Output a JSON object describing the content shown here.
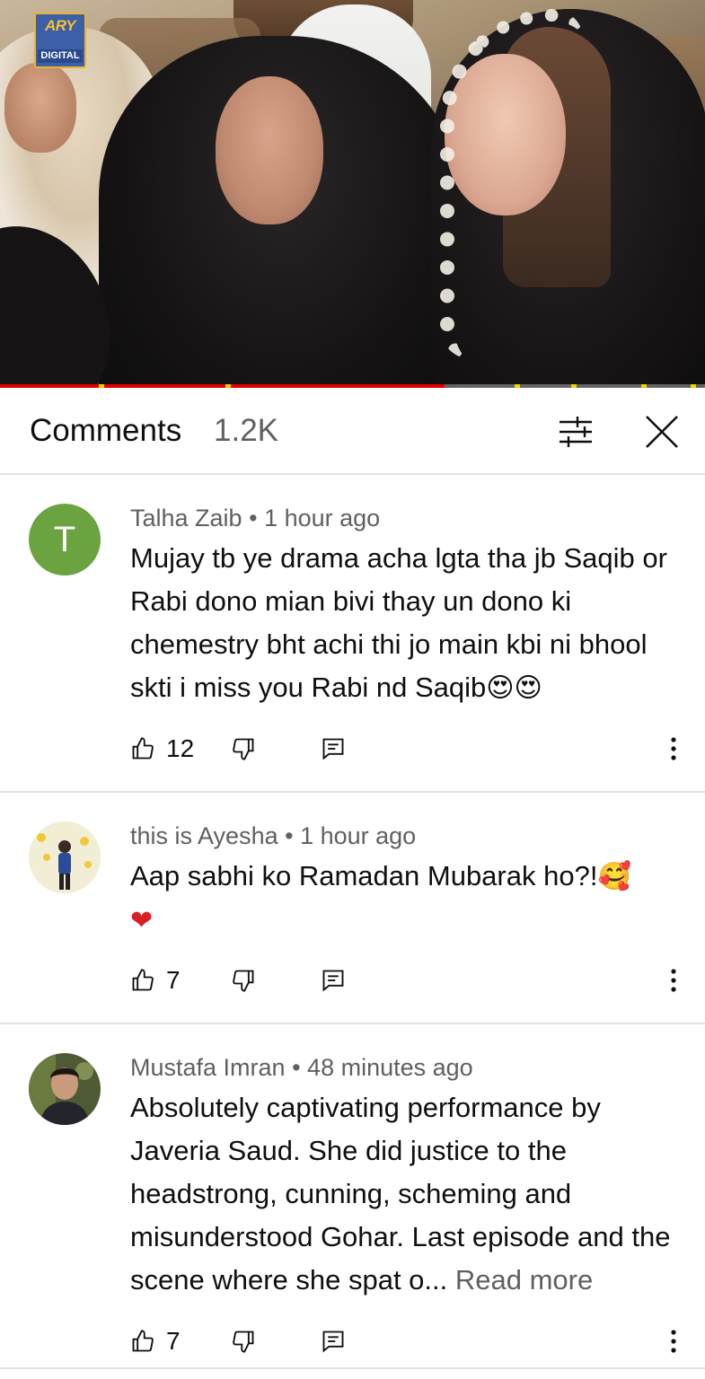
{
  "video": {
    "channel_logo": {
      "line1": "ARY",
      "line2": "DIGITAL"
    },
    "progress": 0.63,
    "chapter_marks": [
      0.14,
      0.32,
      0.73,
      0.81,
      0.91,
      0.98
    ],
    "colors": {
      "progress": "#e00000",
      "chapter": "#f2d400"
    }
  },
  "header": {
    "title": "Comments",
    "count": "1.2K",
    "filter_icon": "sliders-icon",
    "close_icon": "close-icon"
  },
  "comments": [
    {
      "avatar_letter": "T",
      "avatar_color": "#6aa340",
      "author": "Talha Zaib",
      "time": "1 hour ago",
      "text": "Mujay tb ye drama acha lgta tha jb Saqib or Rabi dono mian bivi thay un dono ki chemestry bht achi thi jo main kbi ni bhool skti i miss you Rabi nd Saqib",
      "emoji": "😍😍",
      "likes": "12"
    },
    {
      "author": "this is Ayesha",
      "time": "1 hour ago",
      "text": "Aap sabhi ko Ramadan Mubarak ho?!",
      "emoji": "🥰",
      "emoji2": "❤",
      "likes": "7"
    },
    {
      "author": "Mustafa Imran",
      "time": "48 minutes ago",
      "text": "Absolutely captivating performance by Javeria Saud. She did justice to the headstrong, cunning, scheming and misunderstood Gohar. Last episode and the scene where she spat o...",
      "read_more": "Read more",
      "likes": "7"
    }
  ]
}
